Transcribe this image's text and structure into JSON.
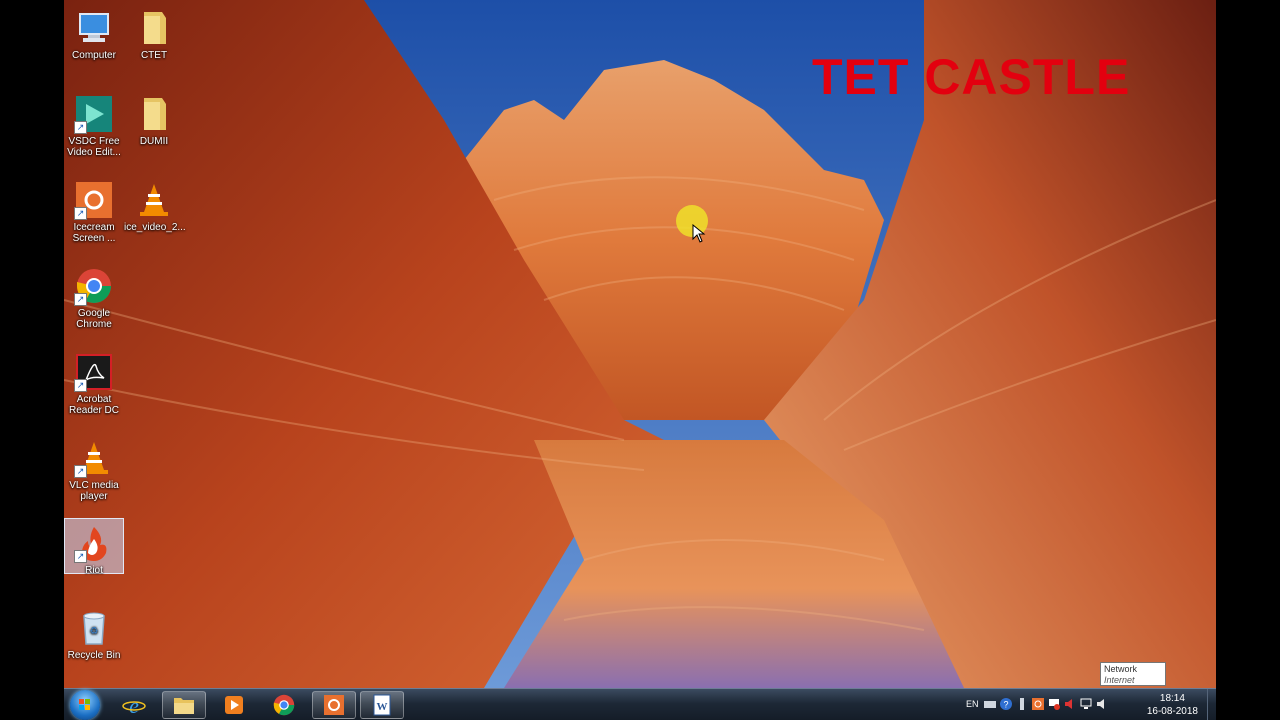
{
  "desktop": {
    "icons": [
      {
        "id": "computer",
        "label": "Computer"
      },
      {
        "id": "ctet",
        "label": "CTET"
      },
      {
        "id": "vsdc",
        "label": "VSDC Free\nVideo Edit..."
      },
      {
        "id": "dumii",
        "label": "DUMII"
      },
      {
        "id": "icecream",
        "label": "Icecream\nScreen ..."
      },
      {
        "id": "ice-video",
        "label": "ice_video_2..."
      },
      {
        "id": "chrome",
        "label": "Google\nChrome"
      },
      {
        "id": "acrobat",
        "label": "Acrobat\nReader DC"
      },
      {
        "id": "vlc",
        "label": "VLC media\nplayer"
      },
      {
        "id": "riot",
        "label": "Riot"
      },
      {
        "id": "recycle",
        "label": "Recycle Bin"
      }
    ],
    "watermark": "TET CASTLE"
  },
  "taskbar": {
    "pinned": [
      {
        "id": "ie",
        "icon": "internet-explorer-icon"
      },
      {
        "id": "explorer",
        "icon": "folder-icon"
      },
      {
        "id": "media",
        "icon": "media-player-icon"
      },
      {
        "id": "chrome",
        "icon": "chrome-icon"
      },
      {
        "id": "icecream",
        "icon": "icecream-recorder-icon"
      },
      {
        "id": "word",
        "icon": "word-icon"
      }
    ],
    "tray": {
      "language": "EN",
      "time": "18:14",
      "date": "16-08-2018"
    }
  },
  "tooltip": {
    "title": "Network",
    "subtitle": "Internet access"
  },
  "colors": {
    "watermark": "#e3000f",
    "taskbar": "#1d2836",
    "sky": "#3b6fc6",
    "rock": "#d2602a"
  }
}
